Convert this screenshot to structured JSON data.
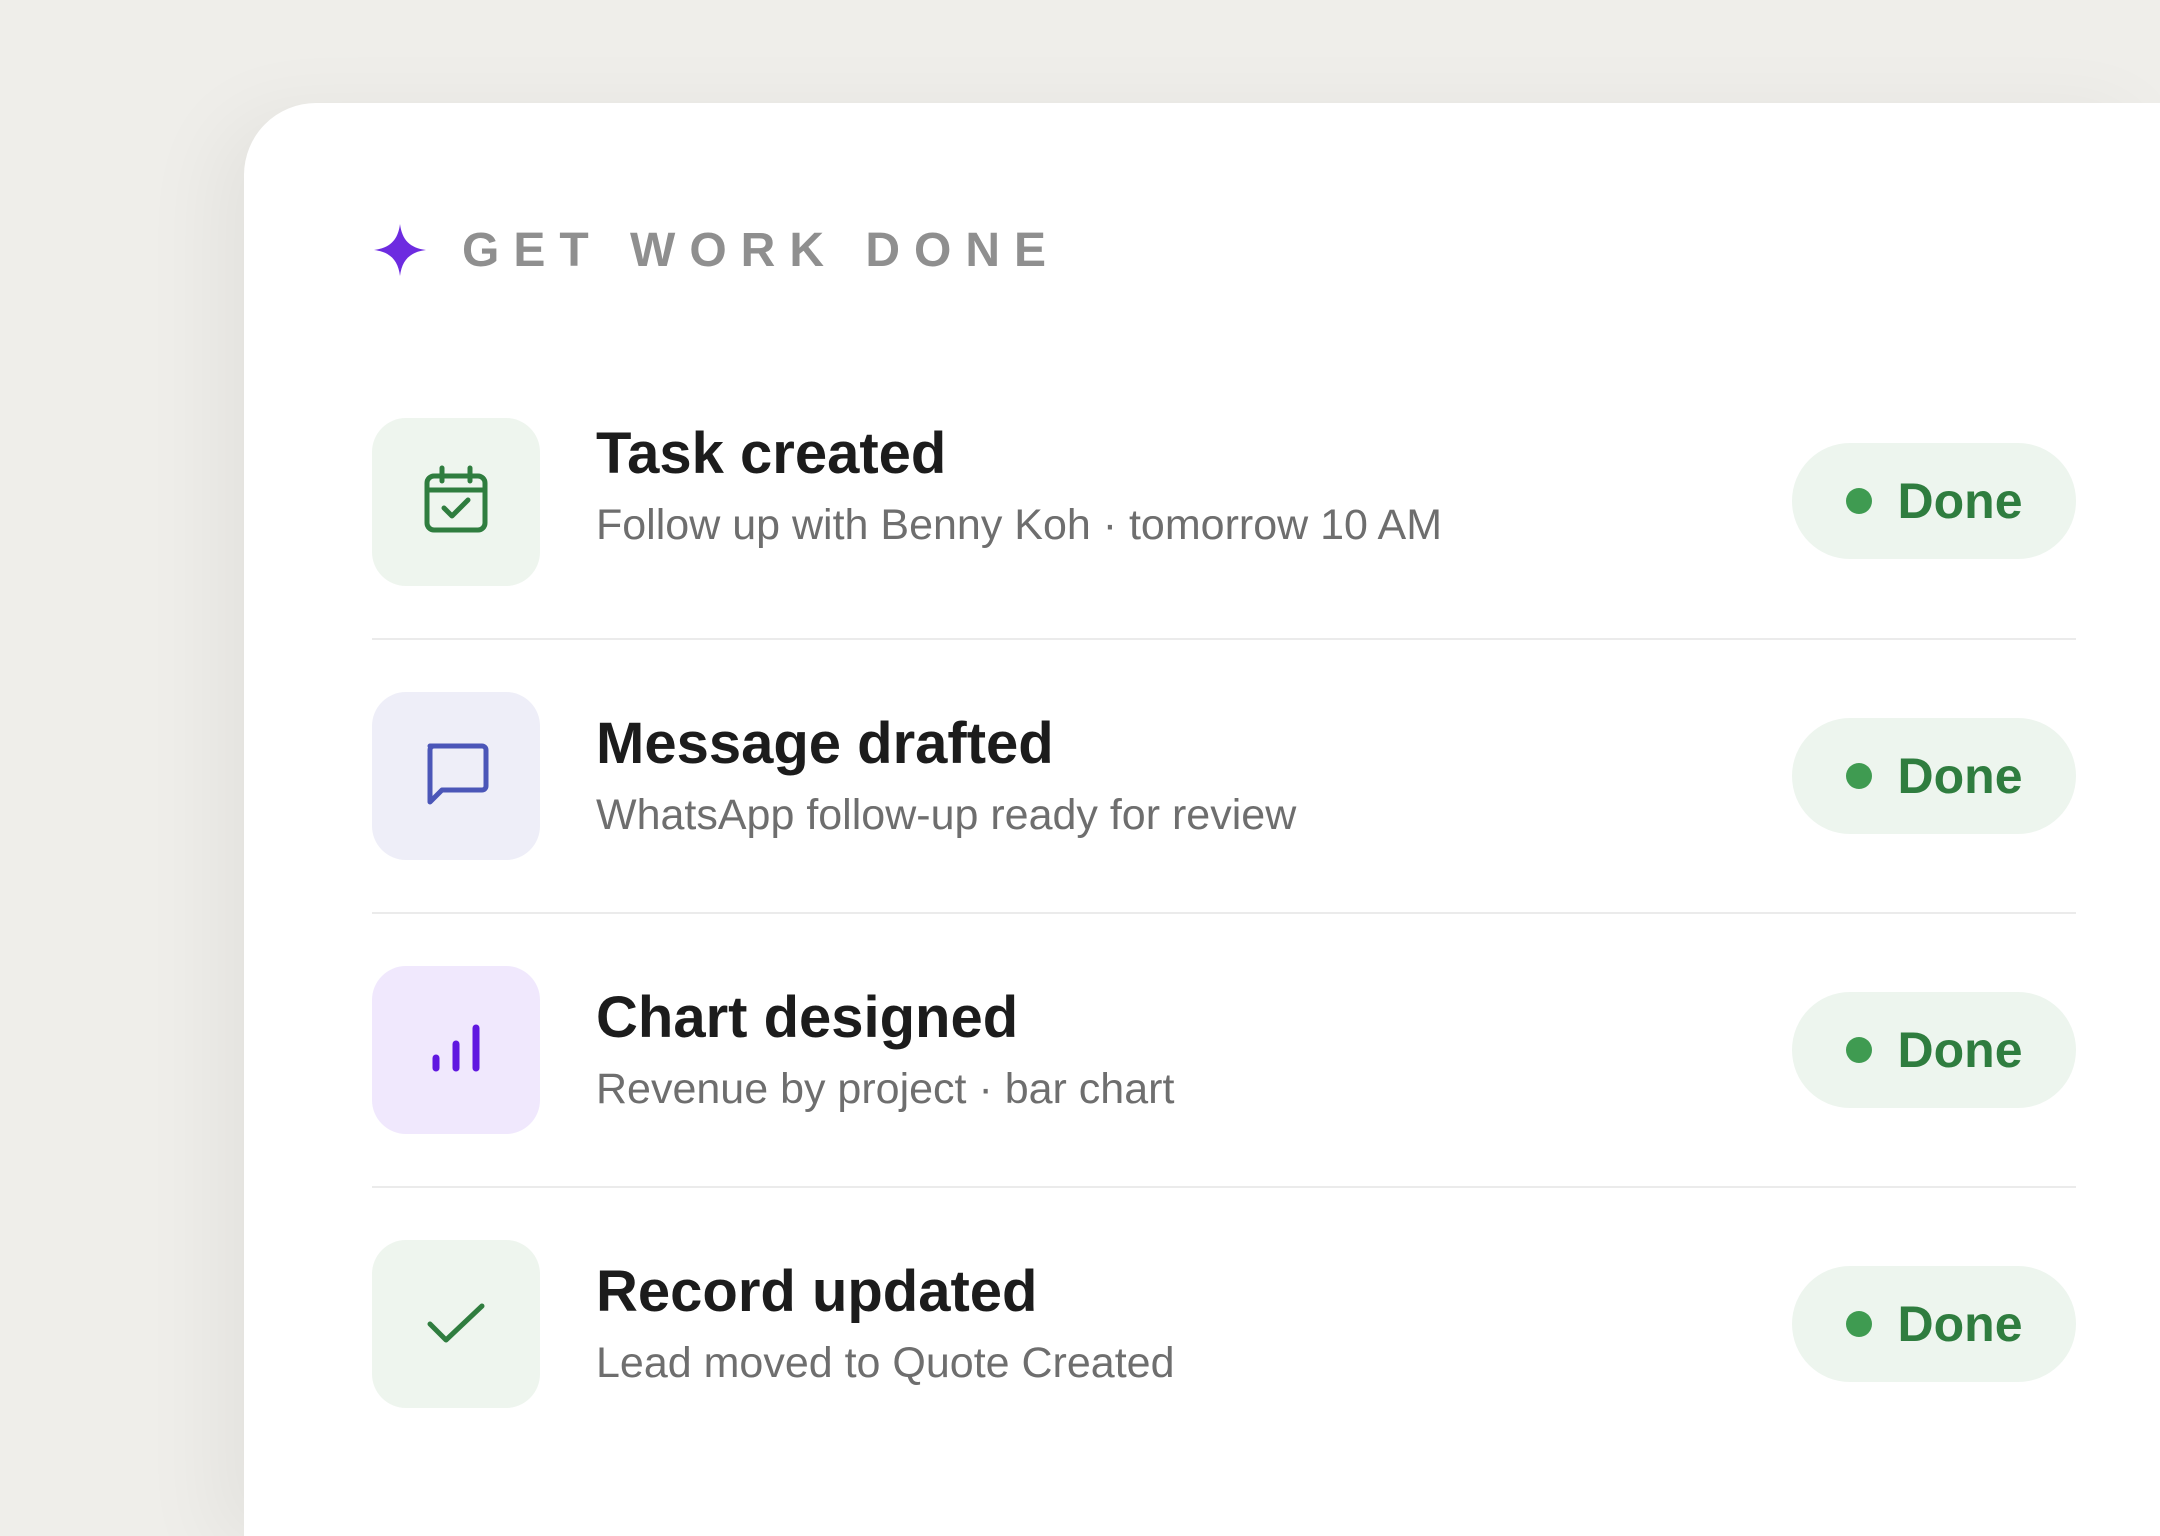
{
  "header": {
    "title": "GET WORK DONE",
    "icon": "sparkle-icon",
    "accent": "#6d2be0"
  },
  "items": [
    {
      "title": "Task created",
      "subtitle": "Follow up with Benny Koh · tomorrow 10 AM",
      "icon": "calendar-check-icon",
      "status": "Done"
    },
    {
      "title": "Message drafted",
      "subtitle": "WhatsApp follow-up ready for review",
      "icon": "chat-bubble-icon",
      "status": "Done"
    },
    {
      "title": "Chart designed",
      "subtitle": "Revenue by project · bar chart",
      "icon": "bar-chart-icon",
      "status": "Done"
    },
    {
      "title": "Record updated",
      "subtitle": "Lead moved to Quote Created",
      "icon": "checkmark-icon",
      "status": "Done"
    }
  ],
  "colors": {
    "status_green": "#3f9b51",
    "status_text": "#2f7d3f"
  }
}
